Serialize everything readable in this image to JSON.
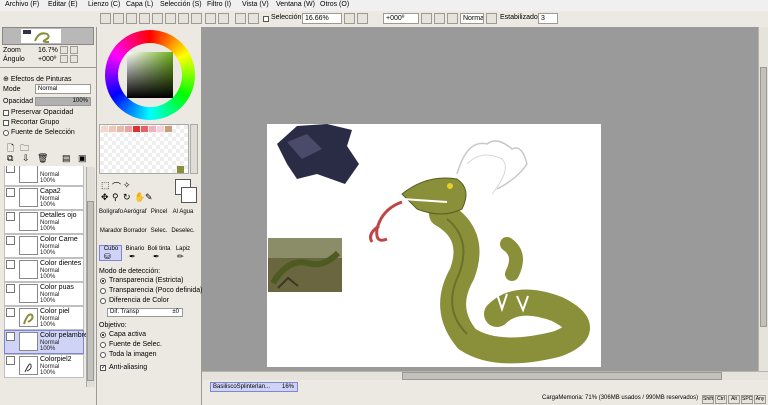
{
  "menu": {
    "items": [
      "Archivo (F)",
      "Editar (E)",
      "Lienzo (C)",
      "Capa (L)",
      "Selección (S)",
      "Filtro (I)",
      "Vista (V)",
      "Ventana (W)",
      "Otros (O)"
    ]
  },
  "toolbar": {
    "selection_label": "Selección",
    "zoom_value": "16.66%",
    "rotation_value": "+000º",
    "mode_value": "Normal",
    "stabilizer_label": "Estabilizador",
    "stabilizer_value": "3"
  },
  "navigator": {
    "zoom_label": "Zoom",
    "zoom_value": "16.7%",
    "angle_label": "Ángulo",
    "angle_value": "+000º"
  },
  "layer_panel": {
    "paint_effects_label": "Efectos de Pinturas",
    "mode_label": "Mode",
    "mode_value": "Normal",
    "opacity_label": "Opacidad",
    "opacity_value": "100%",
    "opacity_fraction": 1.0,
    "preserve_opacity": "Preservar Opacidad",
    "clip_group": "Recortar Grupo",
    "selection_source": "Fuente de Selección",
    "layers": [
      {
        "name": "",
        "mode": "Normal",
        "opacity": "100%",
        "selected": false
      },
      {
        "name": "Capa2",
        "mode": "Normal",
        "opacity": "100%",
        "selected": false
      },
      {
        "name": "Detalles ojo",
        "mode": "Normal",
        "opacity": "100%",
        "selected": false
      },
      {
        "name": "Color Carne",
        "mode": "Normal",
        "opacity": "100%",
        "selected": false
      },
      {
        "name": "Color dientes",
        "mode": "Normal",
        "opacity": "100%",
        "selected": false
      },
      {
        "name": "Color puas",
        "mode": "Normal",
        "opacity": "100%",
        "selected": false
      },
      {
        "name": "Color piel",
        "mode": "Normal",
        "opacity": "100%",
        "selected": false
      },
      {
        "name": "Color pelambre",
        "mode": "Normal",
        "opacity": "100%",
        "selected": true
      },
      {
        "name": "Colorpiel2",
        "mode": "Normal",
        "opacity": "100%",
        "selected": false
      }
    ]
  },
  "tools": {
    "row1": [
      "Bolígrafo",
      "Aerógraf",
      "Pincel",
      "Al Agua"
    ],
    "row2": [
      "Marador",
      "Borrador",
      "Selec.",
      "Deselec."
    ],
    "row3": [
      "Cubo",
      "Binario",
      "Boli tinta",
      "Lapiz"
    ],
    "detection_mode_label": "Modo de detección:",
    "detection_options": [
      "Transparencia (Estricta)",
      "Transparencia (Poco definida)",
      "Diferencia de Color"
    ],
    "diff_label": "Dif. Transp",
    "diff_value": "±0",
    "target_label": "Objetivo:",
    "target_options": [
      "Capa activa",
      "Fuente de Selec.",
      "Toda la imagen"
    ],
    "antialias_label": "Anti-aliasing"
  },
  "swatches": [
    "#f4d7c8",
    "#f0c8b8",
    "#e8b8a8",
    "#f0a0a0",
    "#e03030",
    "#e86060",
    "#f0b0c0",
    "#f8d0d8",
    "#c8a078"
  ],
  "statusbar": {
    "tab_name": "BasiliscoSplinterlan...",
    "tab_zoom": "16%",
    "memory": "CargaMemoria: 71% (306MB usados / 990MB reservados)",
    "buttons": [
      "Shift",
      "Ctrl",
      "Alt",
      "SPC",
      "Any"
    ]
  },
  "colors": {
    "accent": "#7f86d6",
    "snake_green": "#8a8f3a",
    "panel_bg": "#ece9e2",
    "canvas_bg": "#9a9a9a"
  }
}
